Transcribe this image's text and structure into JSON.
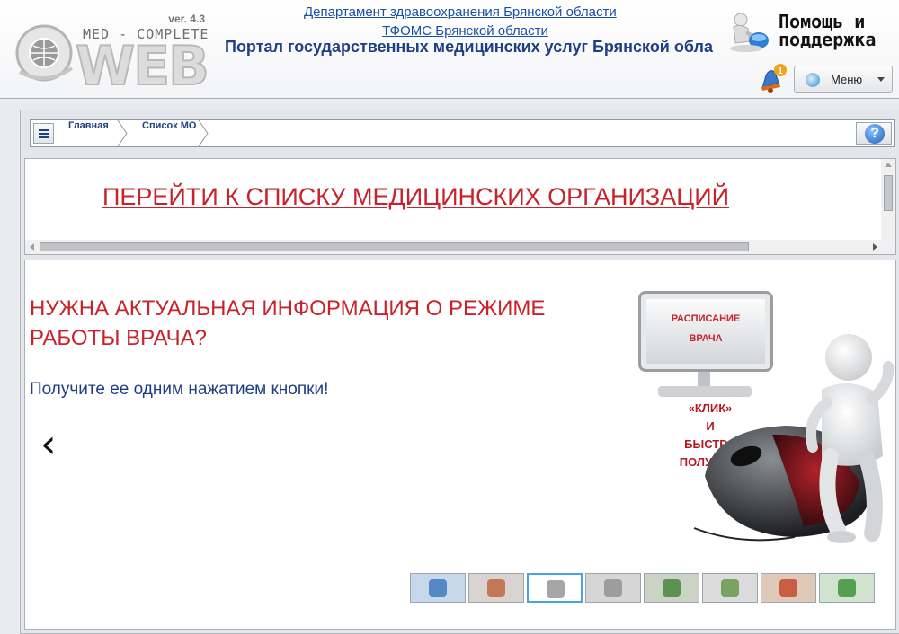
{
  "header": {
    "logo": {
      "version": "ver. 4.3",
      "product_line": "MED - COMPLETE",
      "product_word": "WEB"
    },
    "dept_link": "Департамент здравоохранения Брянской области",
    "tfoms_link": "ТФОМС Брянской области",
    "portal_title": "Портал государственных медицинских услуг Брянской области",
    "help_line1": "Помощь и",
    "help_line2": "поддержка",
    "notification_count": "1",
    "menu_label": "Меню"
  },
  "breadcrumb": {
    "items": [
      "Главная",
      "Список МО"
    ],
    "help_symbol": "?"
  },
  "link_panel": {
    "link_text": "ПЕРЕЙТИ К СПИСКУ МЕДИЦИНСКИХ ОРГАНИЗАЦИЙ"
  },
  "slider": {
    "title": "НУЖНА АКТУАЛЬНАЯ ИНФОРМАЦИЯ О РЕЖИМЕ РАБОТЫ ВРАЧА?",
    "subtitle": "Получите ее одним нажатием кнопки!",
    "prev_symbol": "‹",
    "next_symbol": "›",
    "illustration": {
      "sign_line1": "РАСПИСАНИЕ",
      "sign_line2": "ВРАЧА",
      "cta_line1": "«КЛИК»",
      "cta_line2": "И",
      "cta_line3": "БЫСТРО",
      "cta_line4": "ПОЛУЧАЙ!"
    },
    "thumbnail_count": 8,
    "active_thumbnail": 3
  },
  "colors": {
    "accent_red": "#c8222b",
    "link_blue": "#1a4fa8",
    "title_blue": "#1e3f85",
    "active_thumb_border": "#4aa3e0"
  }
}
